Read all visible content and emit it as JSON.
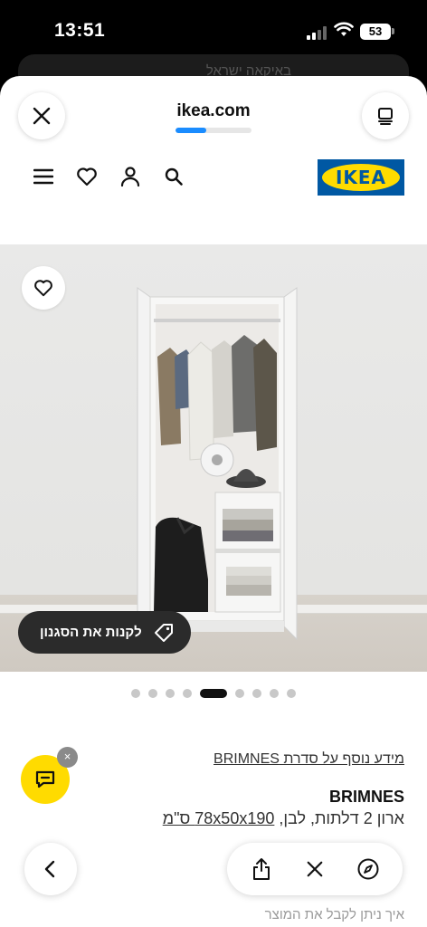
{
  "status_bar": {
    "time": "13:51",
    "battery": "53"
  },
  "behind_sheet": {
    "text": "באיקאה ישראל"
  },
  "browser": {
    "domain": "ikea.com",
    "load_progress": 0.4
  },
  "site": {
    "logo_text": "IKEA"
  },
  "product": {
    "shop_the_look_label": "לקנות את הסגנון",
    "series_link": "מידע נוסף על סדרת BRIMNES",
    "name": "BRIMNES",
    "description": "ארון 2 דלתות, לבן,",
    "dimensions": "78x50x190 ס\"מ"
  },
  "carousel": {
    "count": 9,
    "active_index": 4
  },
  "chat": {
    "dismiss_symbol": "×"
  },
  "delivery_hint": "איך ניתן לקבל את המוצר",
  "icons": {
    "close": "close-icon",
    "tabs": "tabs-icon",
    "menu": "menu-icon",
    "wishlist": "heart-icon",
    "account": "person-icon",
    "search": "search-icon",
    "chat": "chat-icon",
    "tag": "tag-icon",
    "back": "chevron-left-icon",
    "share": "share-icon",
    "compass": "compass-icon"
  },
  "colors": {
    "ikea_blue": "#0058a3",
    "ikea_yellow": "#ffdb00",
    "progress": "#1a8cff"
  }
}
